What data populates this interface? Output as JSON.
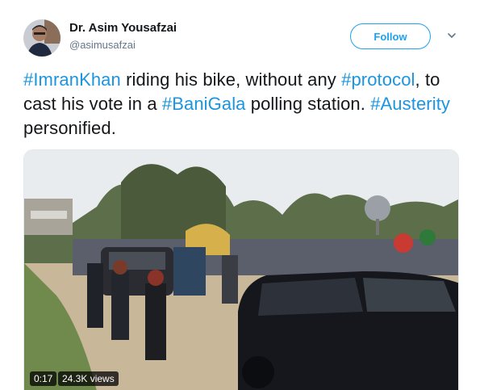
{
  "author": {
    "name": "Dr. Asim Yousafzai",
    "handle": "@asimusafzai"
  },
  "follow_button": {
    "label": "Follow"
  },
  "tweet": {
    "segments": [
      {
        "text": "#ImranKhan",
        "hashtag": true
      },
      {
        "text": " riding his bike, without any ",
        "hashtag": false
      },
      {
        "text": "#protocol",
        "hashtag": true
      },
      {
        "text": ", to cast his vote in a ",
        "hashtag": false
      },
      {
        "text": "#BaniGala",
        "hashtag": true
      },
      {
        "text": " polling station. ",
        "hashtag": false
      },
      {
        "text": "#Austerity",
        "hashtag": true
      },
      {
        "text": " personified.",
        "hashtag": false
      }
    ]
  },
  "video": {
    "duration": "0:17",
    "views": "24.3K views"
  },
  "colors": {
    "accent": "#1da1f2",
    "hashtag": "#1b95e0",
    "text": "#14171a",
    "muted": "#657786"
  },
  "icons": {
    "menu": "chevron-down-icon"
  }
}
